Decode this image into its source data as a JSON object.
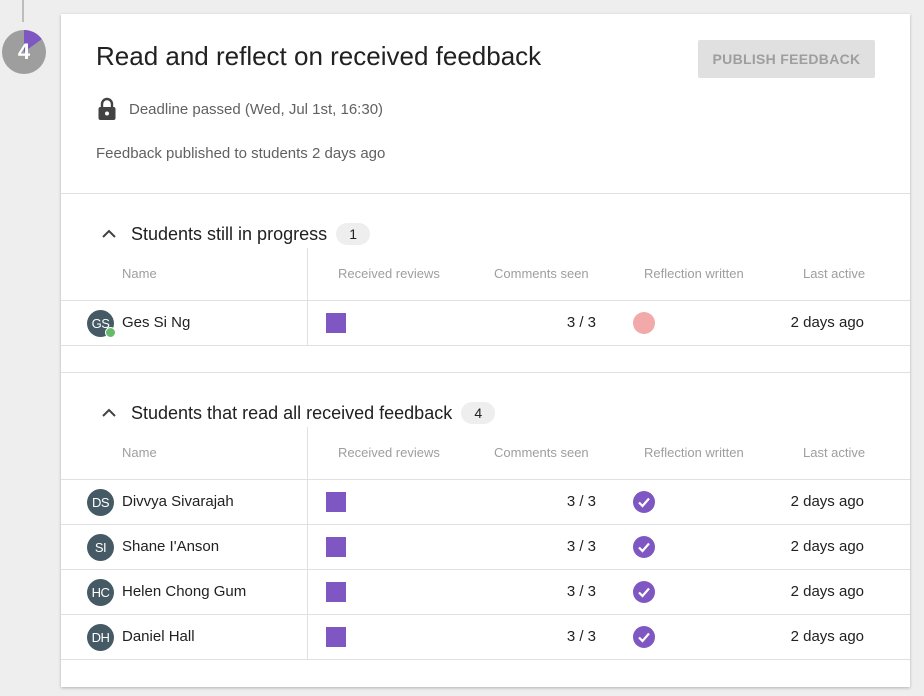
{
  "step": {
    "number": "4",
    "progress_fraction": 0.15,
    "progress_color": "#7e57c2"
  },
  "card": {
    "title": "Read and reflect on received feedback",
    "publish_button_label": "PUBLISH FEEDBACK",
    "deadline_icon": "lock-icon",
    "deadline_text": "Deadline passed (Wed, Jul 1st, 16:30)",
    "published_text": "Feedback published to students 2 days ago"
  },
  "columns": {
    "name": "Name",
    "received_reviews": "Received reviews",
    "comments_seen": "Comments seen",
    "reflection_written": "Reflection written",
    "last_active": "Last active"
  },
  "sections": [
    {
      "title": "Students still in progress",
      "count": "1",
      "expanded": true,
      "rows": [
        {
          "initials": "GS",
          "name": "Ges Si Ng",
          "online": true,
          "comments_seen": "3 / 3",
          "reflection": "pending",
          "last_active": "2 days ago"
        }
      ]
    },
    {
      "title": "Students that read all received feedback",
      "count": "4",
      "expanded": true,
      "rows": [
        {
          "initials": "DS",
          "name": "Divvya Sivarajah",
          "online": false,
          "comments_seen": "3 / 3",
          "reflection": "done",
          "last_active": "2 days ago"
        },
        {
          "initials": "SI",
          "name": "Shane I'Anson",
          "online": false,
          "comments_seen": "3 / 3",
          "reflection": "done",
          "last_active": "2 days ago"
        },
        {
          "initials": "HC",
          "name": "Helen Chong Gum",
          "online": false,
          "comments_seen": "3 / 3",
          "reflection": "done",
          "last_active": "2 days ago"
        },
        {
          "initials": "DH",
          "name": "Daniel Hall",
          "online": false,
          "comments_seen": "3 / 3",
          "reflection": "done",
          "last_active": "2 days ago"
        }
      ]
    }
  ],
  "colors": {
    "accent": "#7e57c2",
    "reflection_pending": "#ef9a9a",
    "online": "#66bb6a",
    "avatar": "#455a64"
  }
}
